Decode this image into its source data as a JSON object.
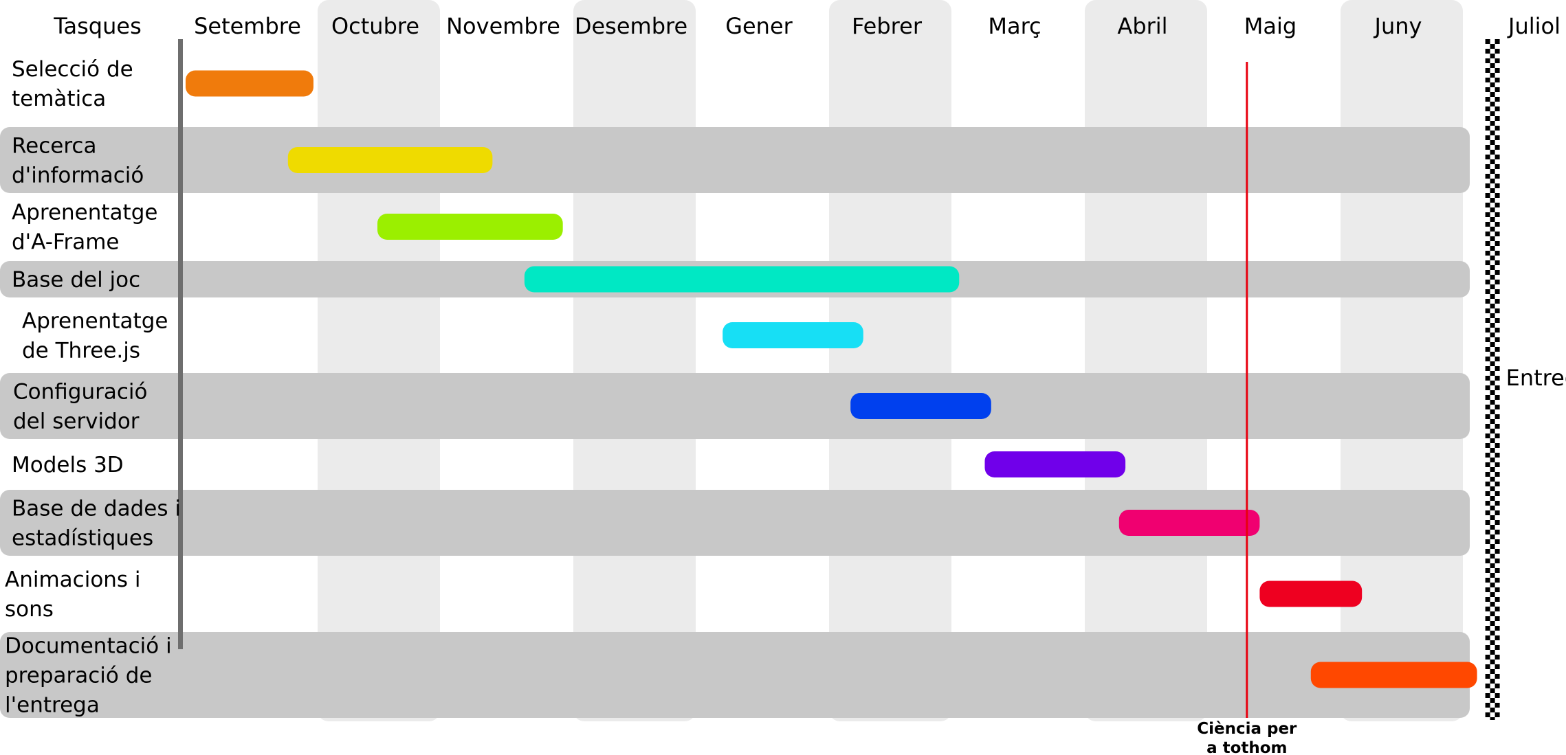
{
  "chart_data": {
    "type": "gantt",
    "header_label": "Tasques",
    "months": [
      "Setembre",
      "Octubre",
      "Novembre",
      "Desembre",
      "Gener",
      "Febrer",
      "Març",
      "Abril",
      "Maig",
      "Juny",
      "Juliol"
    ],
    "tasks": [
      {
        "label": [
          "Selecció de",
          "temàtica"
        ],
        "start": 0.0,
        "end": 1.0,
        "color": "#f07b0c"
      },
      {
        "label": [
          "Recerca",
          "d'informació"
        ],
        "start": 0.8,
        "end": 2.4,
        "color": "#efdb00"
      },
      {
        "label": [
          "Aprenentatge",
          "d'A-Frame"
        ],
        "start": 1.5,
        "end": 2.95,
        "color": "#9bef00"
      },
      {
        "label": [
          "Base del joc"
        ],
        "start": 2.65,
        "end": 6.05,
        "color": "#00e8c4"
      },
      {
        "label": [
          "Aprenentatge",
          "de Three.js"
        ],
        "start": 4.2,
        "end": 5.3,
        "color": "#17dff5"
      },
      {
        "label": [
          "Configuració",
          "del servidor"
        ],
        "start": 5.2,
        "end": 6.3,
        "color": "#0040ee"
      },
      {
        "label": [
          "Models 3D"
        ],
        "start": 6.25,
        "end": 7.35,
        "color": "#7000ea"
      },
      {
        "label": [
          "Base de dades i",
          "estadístiques"
        ],
        "start": 7.3,
        "end": 8.4,
        "color": "#f00070"
      },
      {
        "label": [
          "Animacions i",
          "sons"
        ],
        "start": 8.4,
        "end": 9.2,
        "color": "#ee0020"
      },
      {
        "label": [
          "Documentació i",
          "preparació de",
          "l'entrega"
        ],
        "start": 8.8,
        "end": 10.1,
        "color": "#ff4800"
      }
    ],
    "milestones": [
      {
        "label": [
          "Ciència per",
          "a tothom"
        ],
        "position": 8.3,
        "color": "#e8000f"
      }
    ],
    "deadline": {
      "label": "Entrega",
      "position": 10.1
    },
    "colors": {
      "alt_row": "#c8c8c8",
      "alt_month": "#ebebeb",
      "task_axis": "#6e6e6e",
      "text": "#000000"
    }
  }
}
